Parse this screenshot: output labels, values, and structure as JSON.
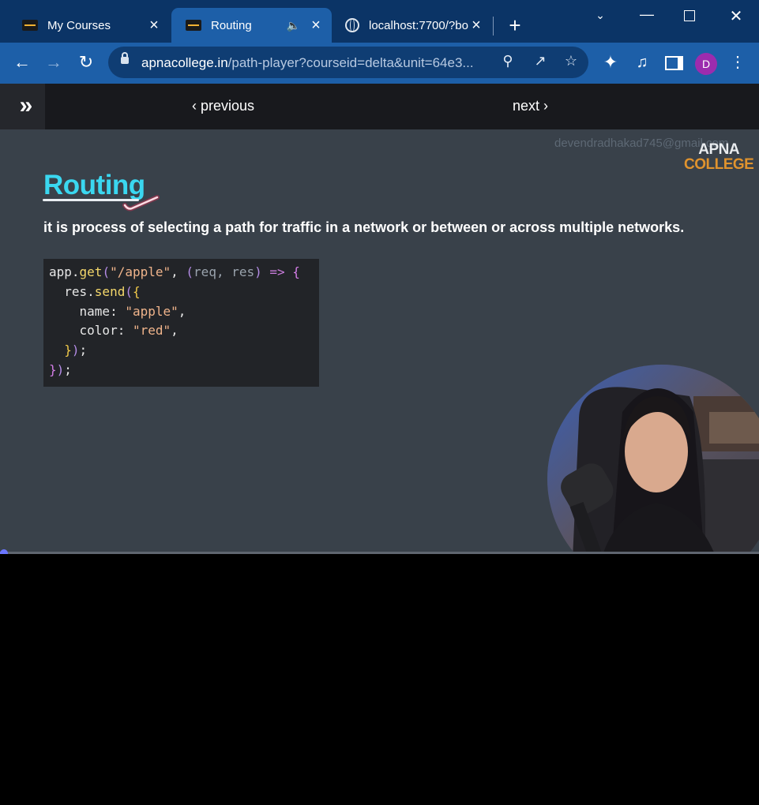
{
  "browser": {
    "tabs": [
      {
        "title": "My Courses",
        "active": false
      },
      {
        "title": "Routing",
        "active": true,
        "audio": true
      },
      {
        "title": "localhost:7700/?bo",
        "active": false
      }
    ],
    "url": {
      "domain": "apnacollege.in",
      "path": "/path-player?courseid=delta&unit=64e3..."
    },
    "profile_initial": "D",
    "colors": {
      "tabstrip": "#0b3466",
      "toolbar": "#1d5fa8",
      "omnibox": "#0f3d73",
      "avatar": "#9c2cae"
    }
  },
  "player_nav": {
    "previous_label": "previous",
    "next_label": "next"
  },
  "slide": {
    "watermark": "devendradhakad745@gmail.com",
    "logo_line1": "APNA",
    "logo_line2": "COLLEGE",
    "title": "Routing",
    "description": "it is process of selecting a path for traffic in a network or between or across multiple networks.",
    "code_lines": [
      "app.get(\"/apple\", (req, res) => {",
      "  res.send({",
      "    name: \"apple\",",
      "    color: \"red\",",
      "  });",
      "});"
    ],
    "colors": {
      "background": "#39414a",
      "title": "#3ad7f0",
      "code_bg": "#222428"
    }
  },
  "video": {
    "progress": 0.005
  }
}
